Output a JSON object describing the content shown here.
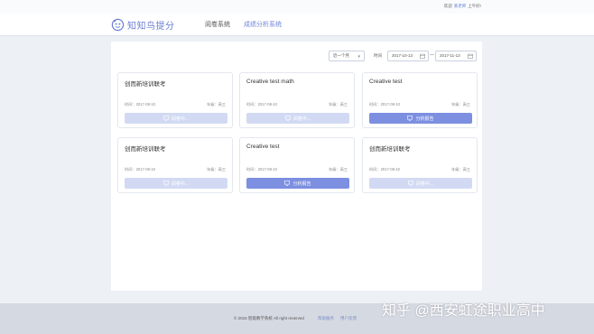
{
  "topbar": {
    "welcome_prefix": "欢迎",
    "username": "某老师",
    "greeting": "上午好!"
  },
  "header": {
    "logo_text": "知知鸟提分",
    "nav": [
      {
        "label": "阅卷系统",
        "active": false
      },
      {
        "label": "成绩分析系统",
        "active": true
      }
    ]
  },
  "filters": {
    "range_select": "近一个月",
    "time_label": "时间",
    "start_date": "2017-10-13",
    "separator": "—",
    "end_date": "2017-11-13"
  },
  "cards": [
    {
      "title": "创而新培训联考",
      "date": "时间：2017-08-10",
      "grade": "年级：高三",
      "button": "阅卷中...",
      "status": "grading"
    },
    {
      "title": "Creative test math",
      "date": "时间：2017-08-10",
      "grade": "年级：高三",
      "button": "阅卷中...",
      "status": "grading"
    },
    {
      "title": "Creative test",
      "date": "时间：2017-08-10",
      "grade": "年级：高三",
      "button": "分析报告",
      "status": "report"
    },
    {
      "title": "创而新培训联考",
      "date": "时间：2017-08-10",
      "grade": "年级：高三",
      "button": "阅卷中...",
      "status": "grading"
    },
    {
      "title": "Creative test",
      "date": "时间：2017-08-10",
      "grade": "年级：高三",
      "button": "分析报告",
      "status": "report"
    },
    {
      "title": "创而新培训联考",
      "date": "时间：2017-08-10",
      "grade": "年级：高三",
      "button": "阅卷中...",
      "status": "grading"
    }
  ],
  "footer": {
    "copyright": "© 2016 智能教学系统 All right reserved",
    "links": [
      "帮助服务",
      "用户反馈"
    ]
  },
  "watermark": "知乎 @西安虹途职业高中",
  "colors": {
    "accent": "#7c8fe0",
    "button_disabled": "#d2daf3",
    "nav_active": "#6d84d8",
    "background": "#edf0f5",
    "footer": "#d5d9e2"
  }
}
